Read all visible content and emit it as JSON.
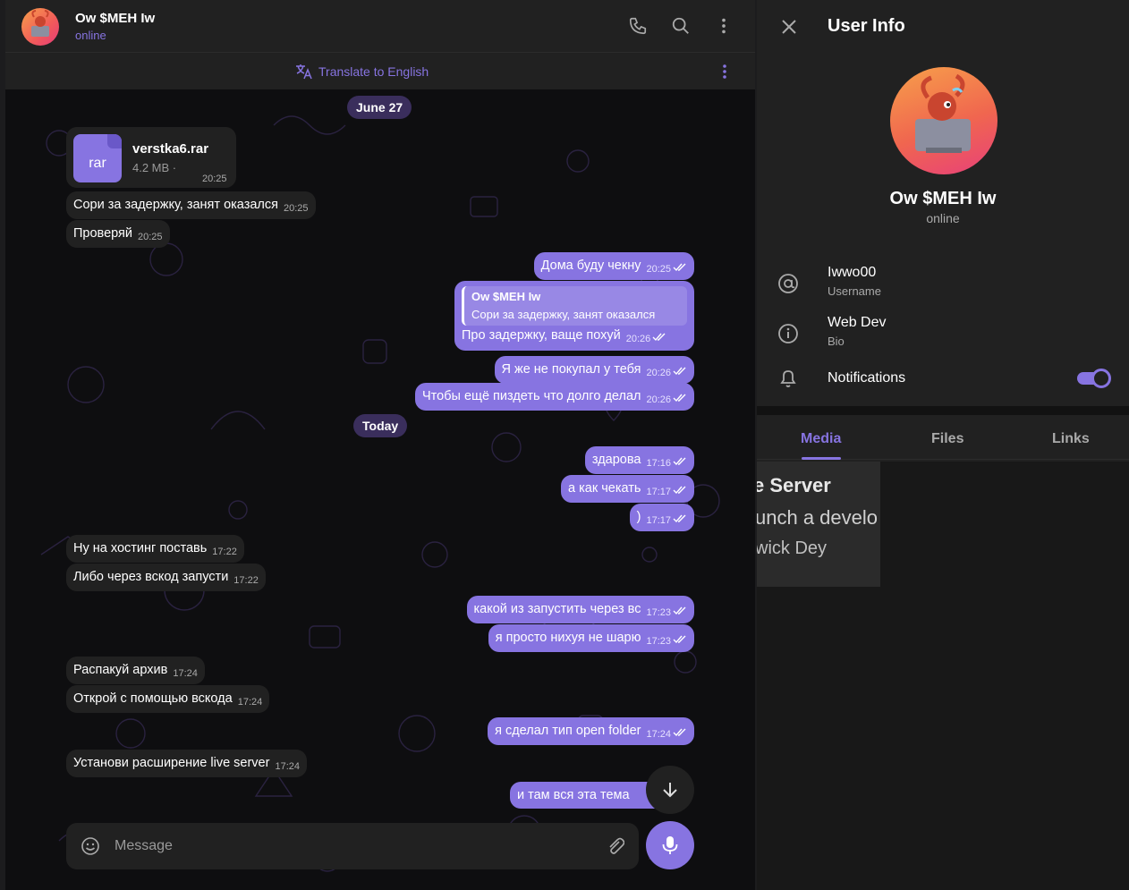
{
  "header": {
    "name": "Ow $MEH Iw",
    "status": "online",
    "translate_label": "Translate to English"
  },
  "dates": {
    "first": "June 27",
    "second": "Today"
  },
  "file": {
    "name": "verstka6.rar",
    "ext": "rar",
    "size": "4.2 MB ·",
    "time": "20:25"
  },
  "reply_quote": {
    "name": "Ow $MEH Iw",
    "text": "Сори за задержку, занят оказался",
    "body": "Про задержку, ваще похуй",
    "time": "20:26"
  },
  "messages": [
    {
      "dir": "in",
      "text": "Сори за задержку, занят оказался",
      "time": "20:25"
    },
    {
      "dir": "in",
      "text": "Проверяй",
      "time": "20:25"
    },
    {
      "dir": "out",
      "text": "Дома буду чекну",
      "time": "20:25"
    },
    {
      "dir": "out",
      "text": "Я же не покупал у тебя",
      "time": "20:26"
    },
    {
      "dir": "out",
      "text": "Чтобы ещё пиздеть что долго делал",
      "time": "20:26"
    },
    {
      "dir": "out",
      "text": "здарова",
      "time": "17:16"
    },
    {
      "dir": "out",
      "text": "а как чекать",
      "time": "17:17"
    },
    {
      "dir": "out",
      "text": ")",
      "time": "17:17"
    },
    {
      "dir": "in",
      "text": "Ну на хостинг поставь",
      "time": "17:22"
    },
    {
      "dir": "in",
      "text": "Либо через вскод запусти",
      "time": "17:22"
    },
    {
      "dir": "out",
      "text": "какой из запустить через вс",
      "time": "17:23"
    },
    {
      "dir": "out",
      "text": "я просто нихуя не шарю",
      "time": "17:23"
    },
    {
      "dir": "in",
      "text": "Распакуй архив",
      "time": "17:24"
    },
    {
      "dir": "in",
      "text": "Открой с помощью вскода",
      "time": "17:24"
    },
    {
      "dir": "out",
      "text": "я сделал тип open folder",
      "time": "17:24"
    },
    {
      "dir": "in",
      "text": "Установи расширение live server",
      "time": "17:24"
    },
    {
      "dir": "out",
      "text": "и там вся эта тема",
      "time": ""
    }
  ],
  "composer": {
    "placeholder": "Message"
  },
  "panel": {
    "title": "User Info",
    "name": "Ow $MEH Iw",
    "status": "online",
    "username_value": "Iwwo00",
    "username_label": "Username",
    "bio_value": "Web Dev",
    "bio_label": "Bio",
    "notifications_label": "Notifications",
    "notifications_on": true,
    "tabs": [
      "Media",
      "Files",
      "Links"
    ],
    "media_preview_lines": [
      "e Server",
      "unch a develo",
      "wick Dey"
    ]
  },
  "colors": {
    "accent": "#8774e1",
    "panel_bg": "#212121",
    "chat_bg": "#0e0e10"
  }
}
